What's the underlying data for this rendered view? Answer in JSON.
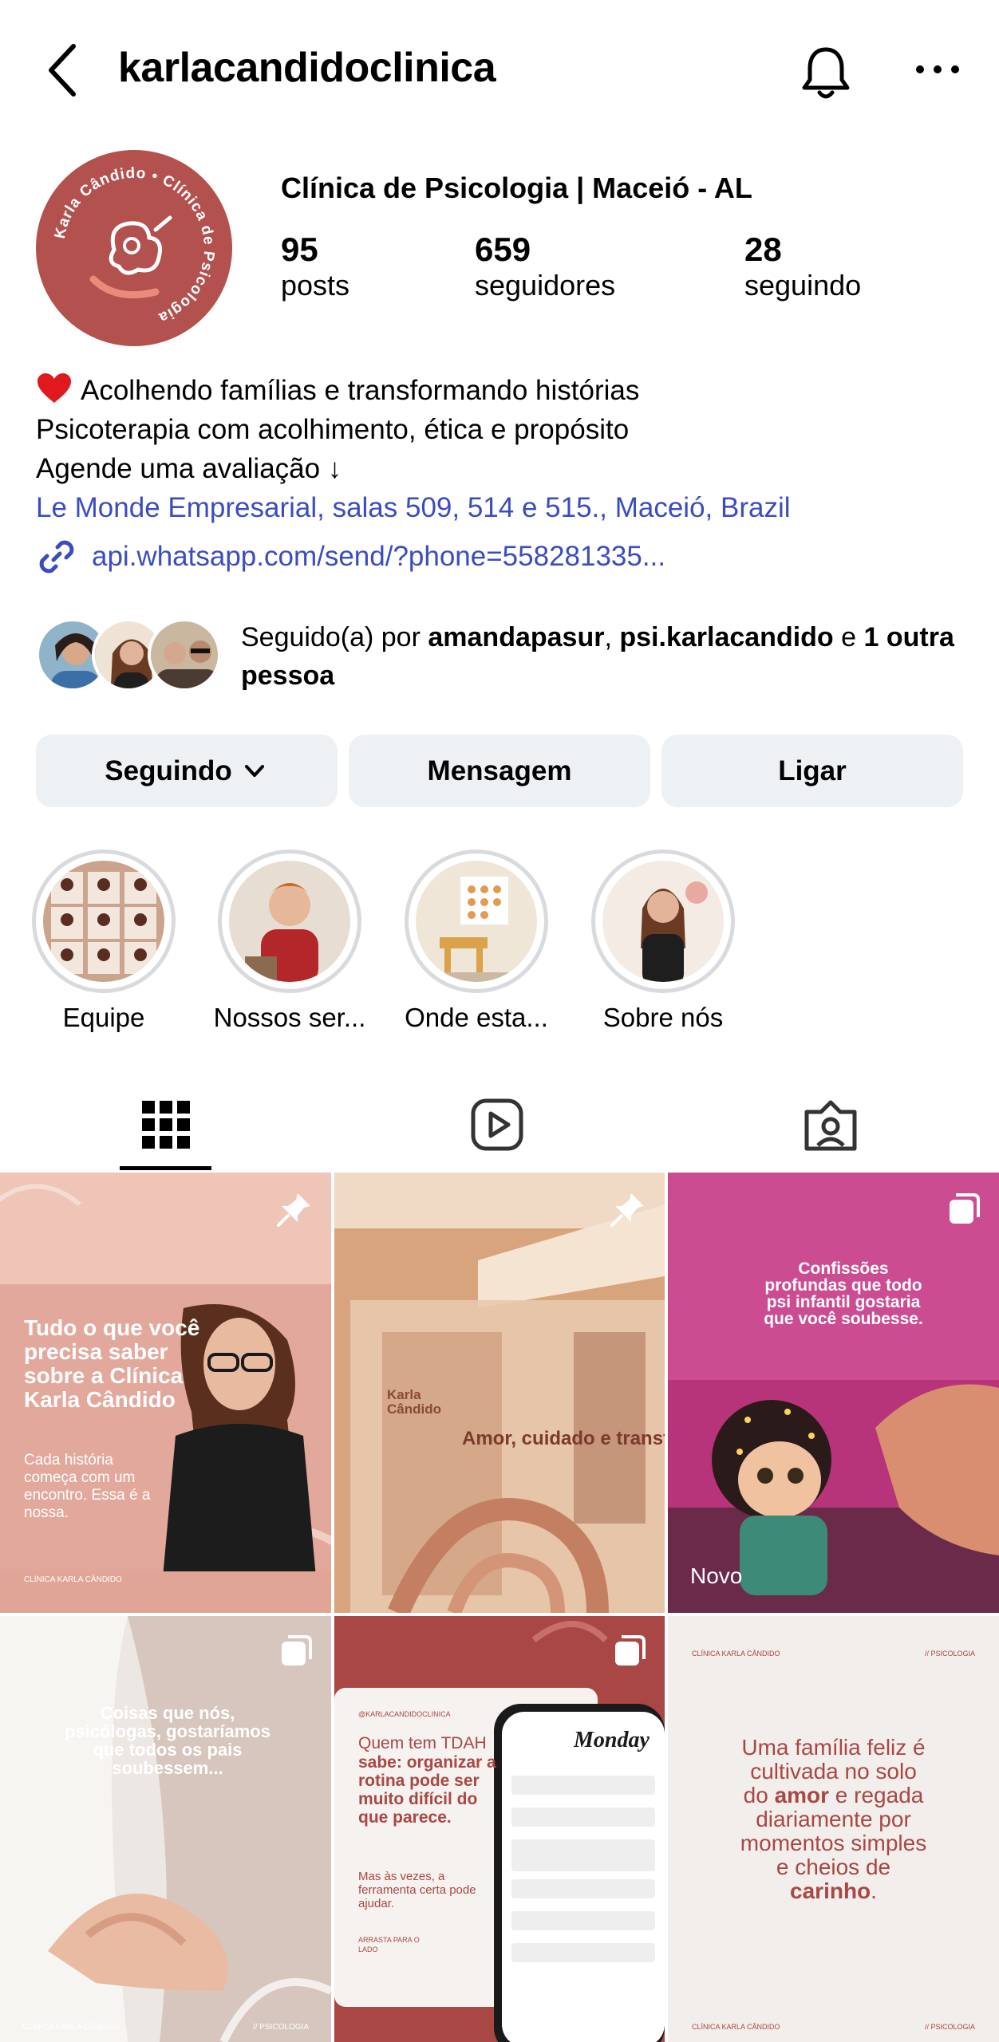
{
  "header": {
    "username": "karlacandidoclinica",
    "icons": [
      "back-arrow-icon",
      "bell-icon",
      "more-options-icon"
    ]
  },
  "profile": {
    "display_name": "Clínica de Psicologia | Maceió - AL",
    "avatar_text": "Karla Cândido • Clínica de Psicologia",
    "stats": [
      {
        "value": "95",
        "label": "posts"
      },
      {
        "value": "659",
        "label": "seguidores"
      },
      {
        "value": "28",
        "label": "seguindo"
      }
    ],
    "bio": {
      "line1": "Acolhendo famílias e transformando histórias",
      "line2": "Psicoterapia com acolhimento, ética e propósito",
      "line3": "Agende uma avaliação ↓",
      "location": "Le Monde Empresarial, salas 509, 514 e 515., Maceió, Brazil",
      "link": "api.whatsapp.com/send/?phone=558281335..."
    },
    "followed_by": {
      "prefix": "Seguido(a) por ",
      "user1": "amandapasur",
      "sep": ", ",
      "user2": "psi.karlacandido",
      "conj": " e ",
      "others": "1 outra pessoa"
    }
  },
  "buttons": {
    "following": "Seguindo",
    "message": "Mensagem",
    "call": "Ligar"
  },
  "highlights": [
    {
      "label": "Equipe"
    },
    {
      "label": "Nossos ser..."
    },
    {
      "label": "Onde esta..."
    },
    {
      "label": "Sobre nós"
    }
  ],
  "tabs": [
    "grid-icon",
    "reels-icon",
    "tagged-icon"
  ],
  "posts": {
    "p1": {
      "title": "Tudo o que você precisa saber sobre a Clínica Karla Cândido",
      "sub": "Cada história começa com um encontro. Essa é a nossa.",
      "footer": "CLÍNICA KARLA CÂNDIDO"
    },
    "p2": {
      "sign": "Karla Cândido",
      "wall": "Amor, cuidado e transforma"
    },
    "p3": {
      "title": "Confissões profundas que todo psi infantil gostaria que você soubesse.",
      "tag": "Novo"
    },
    "p4": {
      "title": "Coisas que nós, psicólogas, gostaríamos que todos os pais soubessem...",
      "footer_left": "CLÍNICA KARLA CÂNDIDO",
      "footer_right": "// PSICOLOGIA"
    },
    "p5": {
      "handle": "@KARLACANDIDOCLINICA",
      "t1": "Quem tem TDAH",
      "t2": "sabe: organizar a rotina pode ser muito difícil do que parece.",
      "t3": "Mas às vezes, a ferramenta certa pode ajudar.",
      "t4": "ARRASTA PARA O LADO",
      "phone_title": "Monday"
    },
    "p6": {
      "header_left": "CLÍNICA KARLA CÂNDIDO",
      "header_right": "// PSICOLOGIA",
      "a": "Uma família feliz é cultivada no solo do ",
      "b": "amor",
      "c": " e regada diariamente por momentos simples e cheios de ",
      "d": "carinho",
      "e": ".",
      "footer_left": "CLÍNICA KARLA CÂNDIDO",
      "footer_right": "// PSICOLOGIA"
    }
  },
  "colors": {
    "brand": "#b3514e",
    "link": "#3b4cc0",
    "button_bg": "#eef1f4"
  }
}
